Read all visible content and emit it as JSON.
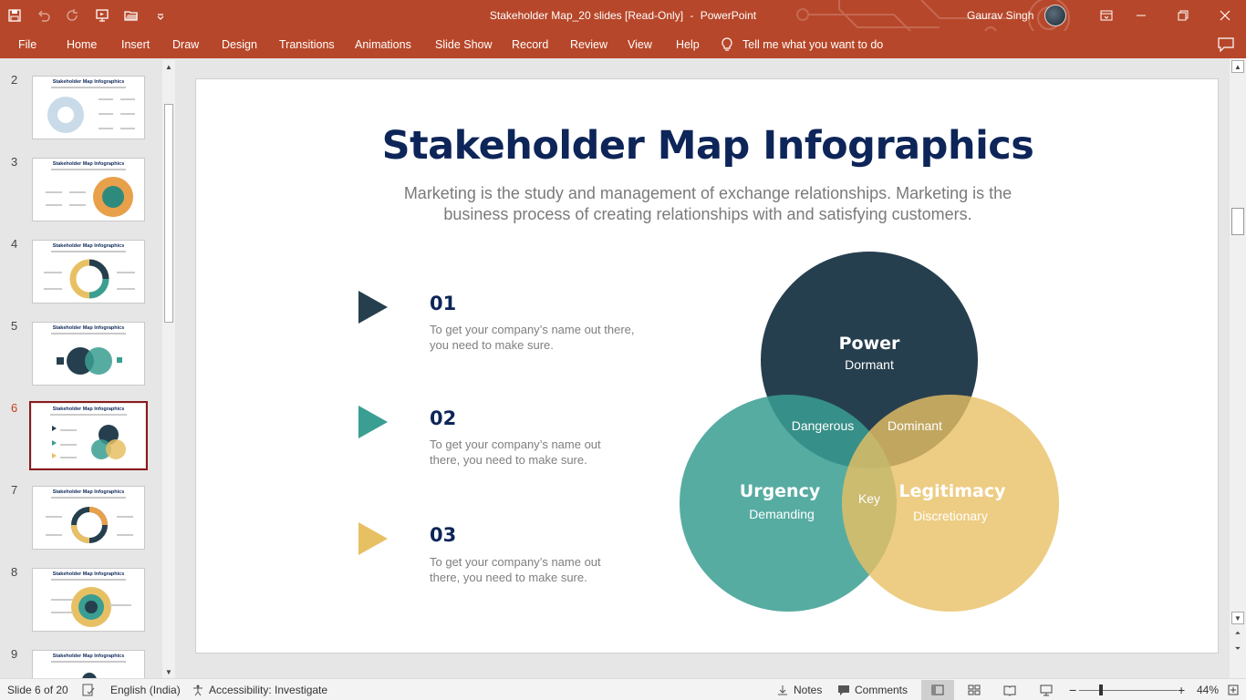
{
  "titlebar": {
    "document_title": "Stakeholder Map_20 slides [Read-Only]",
    "separator": "-",
    "app_name": "PowerPoint",
    "user_name": "Gaurav Singh"
  },
  "menu": {
    "file": "File",
    "home": "Home",
    "insert": "Insert",
    "draw": "Draw",
    "design": "Design",
    "transitions": "Transitions",
    "animations": "Animations",
    "slide_show": "Slide Show",
    "record": "Record",
    "review": "Review",
    "view": "View",
    "help": "Help",
    "tell_me": "Tell me what you want to do"
  },
  "thumbnails": {
    "items": [
      {
        "number": "2",
        "title": "Stakeholder Map Infographics"
      },
      {
        "number": "3",
        "title": "Stakeholder Map Infographics"
      },
      {
        "number": "4",
        "title": "Stakeholder Map Infographics"
      },
      {
        "number": "5",
        "title": "Stakeholder Map Infographics"
      },
      {
        "number": "6",
        "title": "Stakeholder Map Infographics"
      },
      {
        "number": "7",
        "title": "Stakeholder Map Infographics"
      },
      {
        "number": "8",
        "title": "Stakeholder Map Infographics"
      },
      {
        "number": "9",
        "title": "Stakeholder Map Infographics"
      }
    ],
    "active_number": "6"
  },
  "slide": {
    "title": "Stakeholder Map Infographics",
    "subtitle_line1": "Marketing is the study and management of exchange relationships. Marketing is the",
    "subtitle_line2": "business process of creating relationships with and satisfying customers.",
    "items": [
      {
        "number": "01",
        "line1": "To get your company’s name out there,",
        "line2": "you need to make sure.",
        "color": "#263f4f"
      },
      {
        "number": "02",
        "line1": "To get your company’s name out",
        "line2": "there, you need to make sure.",
        "color": "#3a9e92"
      },
      {
        "number": "03",
        "line1": "To get your company’s name out",
        "line2": "there, you need to make sure.",
        "color": "#e8c064"
      }
    ],
    "venn": {
      "power": "Power",
      "power_sub": "Dormant",
      "urgency": "Urgency",
      "urgency_sub": "Demanding",
      "legitimacy": "Legitimacy",
      "legitimacy_sub": "Discretionary",
      "dangerous": "Dangerous",
      "dominant": "Dominant",
      "key": "Key",
      "colors": {
        "power": "#263f4f",
        "urgency": "#3a9e92",
        "legitimacy": "#e8c064"
      }
    }
  },
  "status": {
    "slide_indicator": "Slide 6 of 20",
    "language": "English (India)",
    "accessibility": "Accessibility: Investigate",
    "notes": "Notes",
    "comments": "Comments",
    "zoom": "44%",
    "zoom_minus": "−",
    "zoom_plus": "+"
  },
  "theme": {
    "accent": "#b7472a",
    "selection": "#8b1a1a"
  }
}
